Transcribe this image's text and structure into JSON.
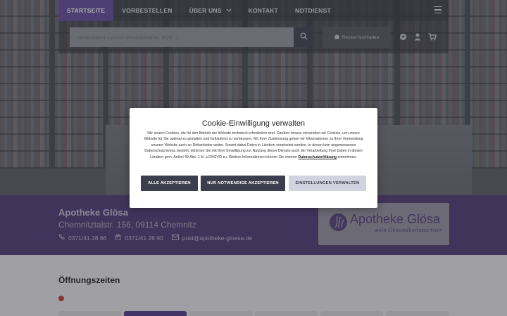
{
  "nav": {
    "items": [
      {
        "label": "STARTSEITE",
        "active": true
      },
      {
        "label": "VORBESTELLEN",
        "active": false
      },
      {
        "label": "ÜBER UNS",
        "active": false,
        "dropdown": true
      },
      {
        "label": "KONTAKT",
        "active": false
      },
      {
        "label": "NOTDIENST",
        "active": false
      }
    ],
    "menu_icon": "hamburger-menu-icon"
  },
  "search": {
    "placeholder": "Medikament suchen (Produktname, PZN...)",
    "button_icon": "search-icon"
  },
  "rezept": {
    "label": "Rezept hochladen",
    "icon": "upload-icon"
  },
  "utility_icons": [
    "location-pin-icon",
    "user-icon",
    "cart-icon"
  ],
  "pharmacy": {
    "name": "Apotheke Glösa",
    "address": "Chemnitztalstr. 156, 09114 Chemnitz",
    "phone": "0371/41 28 86",
    "fax": "0371/41 28 90",
    "email": "post@apotheke-gloesa.de",
    "logo_text": "Apotheke Glösa",
    "logo_tagline": "wein Gesundheitspartner"
  },
  "hours": {
    "title": "Öffnungszeiten",
    "status_color": "#c94646"
  },
  "cookie": {
    "title": "Cookie-Einwilligung verwalten",
    "body": "Wir setzen Cookies, die für den Betrieb der Website technisch erforderlich sind. Darüber hinaus verwenden wir Cookies, um unsere Website für Sie optimal zu gestalten und fortlaufend zu verbessern. Mit Ihrer Zustimmung geben wir Informationen zu Ihrer Verwendung unserer Website auch an Drittanbieter weiter. Soweit dabei Daten in Ländern verarbeitet werden, in denen kein angemessenes Datenschutzniveau besteht, stimmen Sie mit Ihrer Einwilligung zur Nutzung dieser Dienste auch der Verarbeitung Ihrer Daten in diesen Ländern gem. Artikel 49 Abs. 1 lit. a DSGVO zu. Weitere Informationen können Sie unserer",
    "link_text": "Datenschutzerklärung",
    "body_end": " entnehmen.",
    "accept_all": "ALLE AKZEPTIEREN",
    "necessary_only": "NUR NOTWENDIGE AKZEPTIEREN",
    "settings": "EINSTELLUNGEN VERWALTEN"
  },
  "colors": {
    "brand_purple": "#6c56a3",
    "band_purple": "#5a467f",
    "dark_button": "#3b3e4d"
  }
}
